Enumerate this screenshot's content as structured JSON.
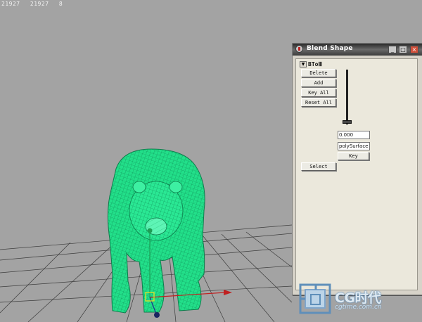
{
  "hud": {
    "stats": [
      "21927",
      "21927",
      "8"
    ]
  },
  "window": {
    "title": "Blend Shape",
    "controls": [
      "_",
      "□",
      "×"
    ],
    "node_name": "BToⅢ",
    "buttons": {
      "delete": "Delete",
      "add": "Add",
      "key_all": "Key All",
      "reset_all": "Reset All",
      "select": "Select",
      "key": "Key"
    },
    "weight_value": "0.000",
    "target_name": "polySurface",
    "slider_value": 0.0
  },
  "watermark": {
    "brand": "CG时代",
    "url": "cgtime.com.cn"
  },
  "colors": {
    "wireframe": "#22e08a",
    "background": "#a3a3a3",
    "x_axis": "#c02020"
  }
}
